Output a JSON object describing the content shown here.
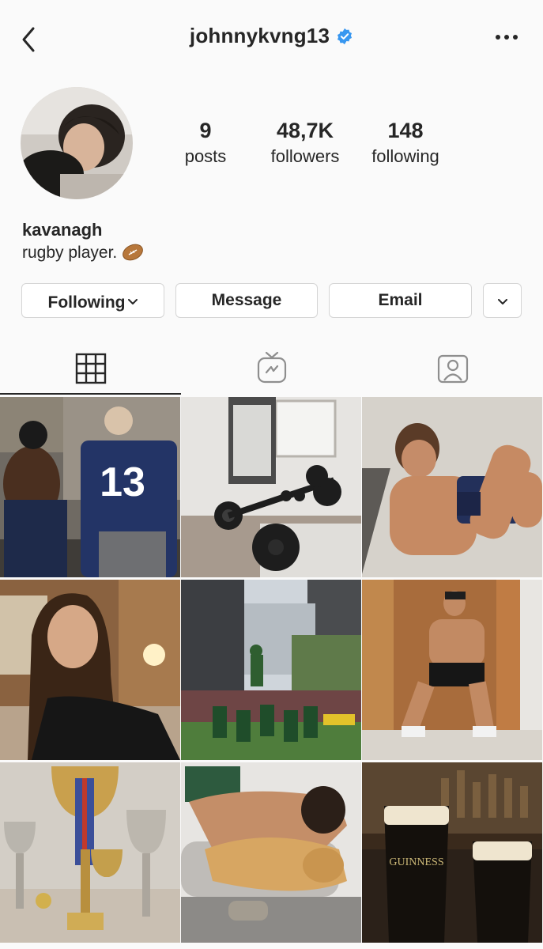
{
  "header": {
    "username": "johnnykvng13",
    "verified": true,
    "back_icon": "chevron-left-icon",
    "more_icon": "ellipsis-icon"
  },
  "profile": {
    "stats": {
      "posts_count": "9",
      "posts_label": "posts",
      "followers_count": "48,7K",
      "followers_label": "followers",
      "following_count": "148",
      "following_label": "following"
    },
    "display_name": "kavanagh",
    "bio": "rugby player."
  },
  "actions": {
    "following_label": "Following",
    "message_label": "Message",
    "email_label": "Email"
  },
  "tabs": [
    {
      "name": "grid",
      "icon": "grid-icon",
      "active": true
    },
    {
      "name": "igtv",
      "icon": "tv-icon",
      "active": false
    },
    {
      "name": "tagged",
      "icon": "tagged-person-icon",
      "active": false
    }
  ],
  "posts_grid_caption": "",
  "colors": {
    "verified_blue": "#3897f0",
    "text": "#262626",
    "background": "#fafafa"
  }
}
